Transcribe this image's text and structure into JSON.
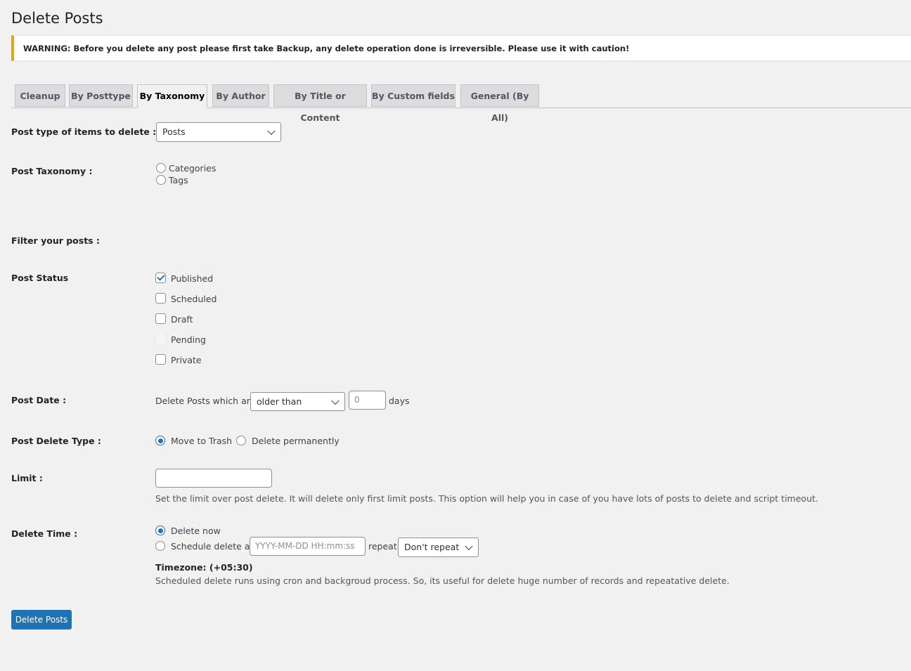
{
  "page": {
    "title": "Delete Posts",
    "warning": "WARNING: Before you delete any post please first take Backup, any delete operation done is irreversible. Please use it with caution!"
  },
  "tabs": [
    {
      "label": "Cleanup",
      "active": false
    },
    {
      "label": "By Posttype",
      "active": false
    },
    {
      "label": "By Taxonomy",
      "active": true
    },
    {
      "label": "By Author",
      "active": false
    },
    {
      "label": "By Title or Content",
      "active": false
    },
    {
      "label": "By Custom fields",
      "active": false
    },
    {
      "label": "General (By All)",
      "active": false
    }
  ],
  "form": {
    "post_type": {
      "label": "Post type of items to delete :",
      "value": "Posts"
    },
    "taxonomy": {
      "label": "Post Taxonomy :",
      "options": [
        "Categories",
        "Tags"
      ],
      "selected": null
    },
    "filter_heading": "Filter your posts :",
    "post_status": {
      "label": "Post Status",
      "options": [
        {
          "label": "Published",
          "checked": true,
          "disabled": false
        },
        {
          "label": "Scheduled",
          "checked": false,
          "disabled": false
        },
        {
          "label": "Draft",
          "checked": false,
          "disabled": false
        },
        {
          "label": "Pending",
          "checked": false,
          "disabled": true
        },
        {
          "label": "Private",
          "checked": false,
          "disabled": false
        }
      ]
    },
    "post_date": {
      "label": "Post Date :",
      "prefix": "Delete Posts which are",
      "comparison": "older than",
      "days_value": "0",
      "suffix": "days"
    },
    "delete_type": {
      "label": "Post Delete Type :",
      "options": [
        "Move to Trash",
        "Delete permanently"
      ],
      "selected": "Move to Trash"
    },
    "limit": {
      "label": "Limit :",
      "value": "",
      "description": "Set the limit over post delete. It will delete only first limit posts. This option will help you in case of you have lots of posts to delete and script timeout."
    },
    "delete_time": {
      "label": "Delete Time :",
      "now_label": "Delete now",
      "schedule_label": "Schedule delete at",
      "selected": "Delete now",
      "datetime_placeholder": "YYYY-MM-DD HH:mm:ss",
      "repeat_label": "repeat",
      "repeat_value": "Don't repeat",
      "timezone": "Timezone: (+05:30)",
      "description": "Scheduled delete runs using cron and backgroud process. So, its useful for delete huge number of records and repeatative delete."
    },
    "submit_label": "Delete Posts"
  },
  "colors": {
    "accent": "#2271b1",
    "warning_border": "#dba617",
    "background": "#f1f1f1"
  }
}
